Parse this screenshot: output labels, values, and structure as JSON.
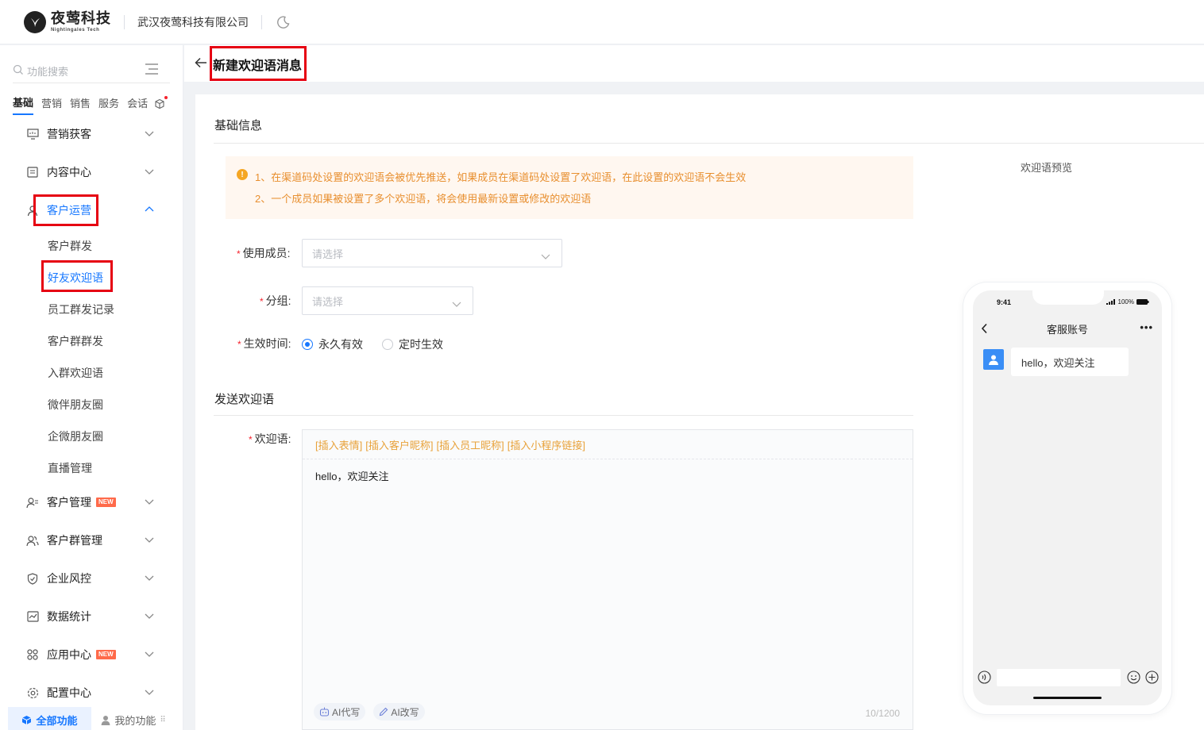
{
  "header": {
    "logo_cn": "夜莺科技",
    "logo_en": "Nightingales Tech",
    "company": "武汉夜莺科技有限公司"
  },
  "sidebar": {
    "search_placeholder": "功能搜索",
    "categories": [
      {
        "label": "基础",
        "active": true
      },
      {
        "label": "营销"
      },
      {
        "label": "销售"
      },
      {
        "label": "服务"
      },
      {
        "label": "会话"
      }
    ],
    "nav": {
      "marketing": "营销获客",
      "content": "内容中心",
      "customer_ops": "客户运营",
      "customer_mgmt": "客户管理",
      "group_mgmt": "客户群管理",
      "risk": "企业风控",
      "stats": "数据统计",
      "apps": "应用中心",
      "config": "配置中心"
    },
    "new_badge": "NEW",
    "sub_items": [
      "客户群发",
      "好友欢迎语",
      "员工群发记录",
      "客户群群发",
      "入群欢迎语",
      "微伴朋友圈",
      "企微朋友圈",
      "直播管理"
    ],
    "bottom_tabs": {
      "all": "全部功能",
      "mine": "我的功能"
    }
  },
  "page": {
    "title": "新建欢迎语消息",
    "section_basic": "基础信息",
    "notice": [
      "1、在渠道码处设置的欢迎语会被优先推送，如果成员在渠道码处设置了欢迎语，在此设置的欢迎语不会生效",
      "2、一个成员如果被设置了多个欢迎语，将会使用最新设置或修改的欢迎语"
    ],
    "form": {
      "member_label": "使用成员:",
      "member_placeholder": "请选择",
      "group_label": "分组:",
      "group_placeholder": "请选择",
      "time_label": "生效时间:",
      "time_options": [
        "永久有效",
        "定时生效"
      ],
      "time_selected": "永久有效"
    },
    "section_send": "发送欢迎语",
    "welcome_label": "欢迎语:",
    "editor": {
      "toolbar": [
        "[插入表情]",
        "[插入客户昵称]",
        "[插入员工昵称]",
        "[插入小程序链接]"
      ],
      "text": "hello，欢迎关注",
      "ai_write": "AI代写",
      "ai_rewrite": "AI改写",
      "count": "10/1200"
    },
    "preview": {
      "label": "欢迎语预览",
      "time": "9:41",
      "battery": "100%",
      "chat_title": "客服账号",
      "message": "hello，欢迎关注"
    }
  },
  "colors": {
    "accent": "#1677ff",
    "highlight": "#e60012",
    "warning": "#f5a623"
  }
}
